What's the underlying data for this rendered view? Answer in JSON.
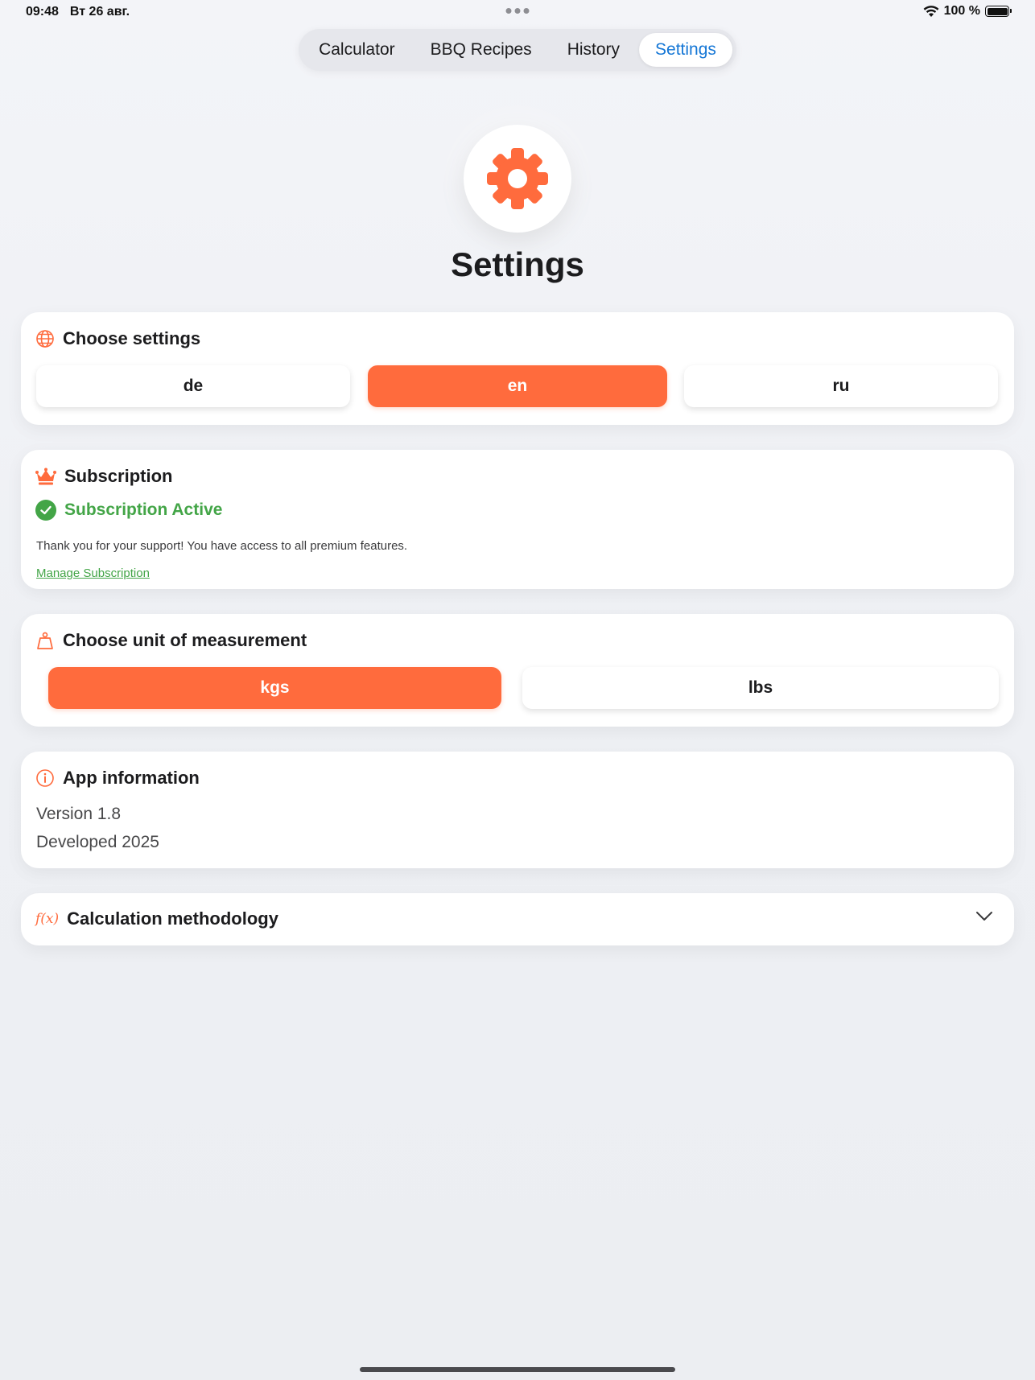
{
  "status_bar": {
    "time": "09:48",
    "date": "Вт 26 авг.",
    "battery": "100 %"
  },
  "tabs": [
    {
      "label": "Calculator",
      "active": false
    },
    {
      "label": "BBQ Recipes",
      "active": false
    },
    {
      "label": "History",
      "active": false
    },
    {
      "label": "Settings",
      "active": true
    }
  ],
  "header": {
    "icon": "gear-icon",
    "title": "Settings"
  },
  "colors": {
    "accent": "#ff6b3d",
    "tab_active": "#1577d6",
    "success": "#43a547"
  },
  "language_card": {
    "title": "Choose settings",
    "icon": "globe-icon",
    "options": [
      "de",
      "en",
      "ru"
    ],
    "selected": "en"
  },
  "subscription_card": {
    "title": "Subscription",
    "icon": "crown-icon",
    "status": "Subscription Active",
    "message": "Thank you for your support! You have access to all premium features.",
    "manage_link": "Manage Subscription"
  },
  "unit_card": {
    "title": "Choose unit of measurement",
    "icon": "weight-icon",
    "options": [
      "kgs",
      "lbs"
    ],
    "selected": "kgs"
  },
  "app_info_card": {
    "title": "App information",
    "icon": "info-icon",
    "version": "Version 1.8",
    "developed": "Developed 2025"
  },
  "methodology_card": {
    "title": "Calculation methodology",
    "icon": "function-icon",
    "icon_text": "f(x)"
  }
}
